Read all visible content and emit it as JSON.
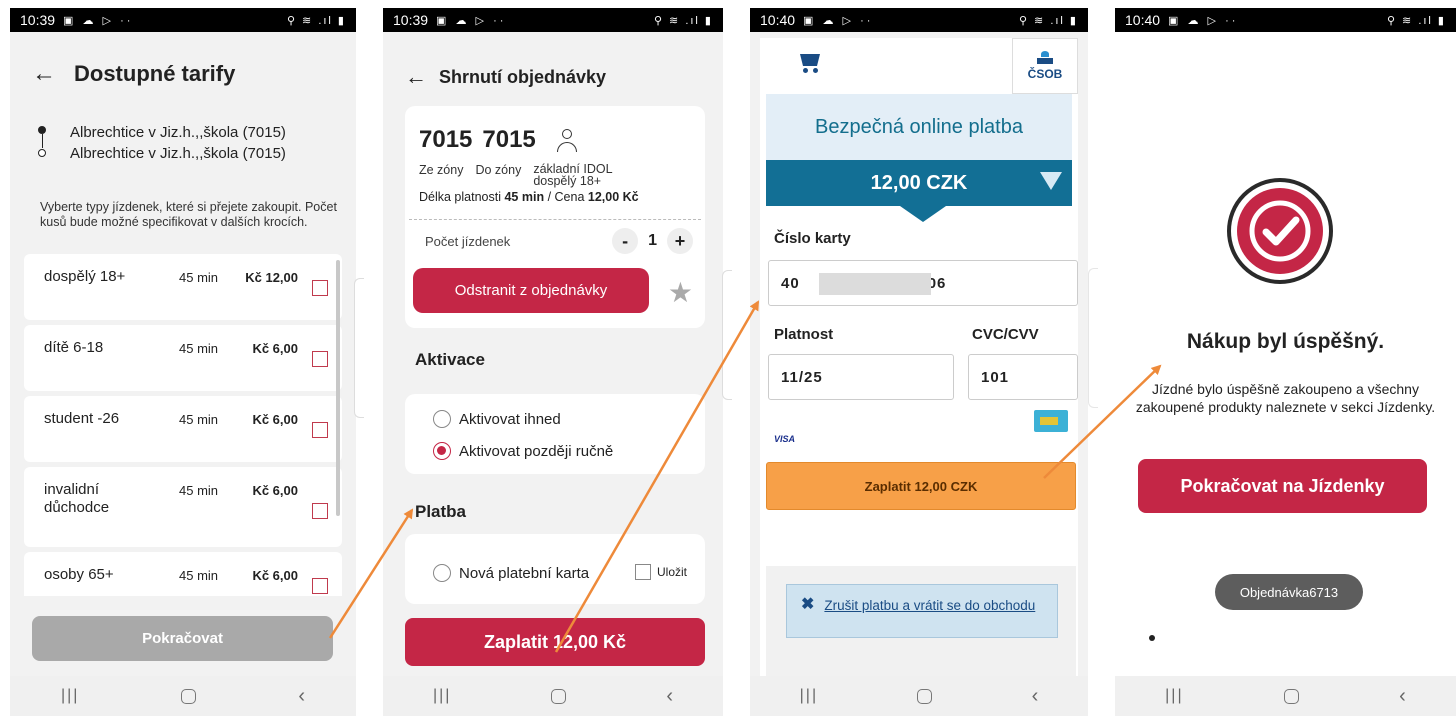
{
  "phone1": {
    "status": {
      "time": "10:39"
    },
    "title": "Dostupné tarify",
    "route": {
      "from": "Albrechtice v Jiz.h.,,škola (7015)",
      "to": "Albrechtice v Jiz.h.,,škola (7015)"
    },
    "hint": "Vyberte typy jízdenek, které si přejete zakoupit. Počet kusů bude možné specifikovat v dalších krocích.",
    "tariffs": [
      {
        "name": "dospělý 18+",
        "duration": "45 min",
        "price": "Kč 12,00"
      },
      {
        "name": "dítě 6-18",
        "duration": "45 min",
        "price": "Kč 6,00"
      },
      {
        "name": "student -26",
        "duration": "45 min",
        "price": "Kč 6,00"
      },
      {
        "name": "invalidní důchodce",
        "duration": "45 min",
        "price": "Kč 6,00"
      },
      {
        "name": "osoby 65+",
        "duration": "45 min",
        "price": "Kč 6,00"
      }
    ],
    "continue_label": "Pokračovat"
  },
  "phone2": {
    "status": {
      "time": "10:39"
    },
    "title": "Shrnutí objednávky",
    "ticket": {
      "zone_from": "7015",
      "zone_to": "7015",
      "from_label": "Ze zóny",
      "to_label": "Do zóny",
      "tariff": "základní IDOL dospělý 18+",
      "validity_label": "Délka platnosti",
      "validity": "45 min",
      "price_label": "/ Cena",
      "price": "12,00 Kč",
      "count_label": "Počet jízdenek",
      "count": "1",
      "remove_label": "Odstranit z objednávky"
    },
    "activation": {
      "title": "Aktivace",
      "options": [
        {
          "label": "Aktivovat ihned",
          "selected": false
        },
        {
          "label": "Aktivovat později ručně",
          "selected": true
        }
      ]
    },
    "payment": {
      "title": "Platba",
      "new_card": "Nová platební karta",
      "save_label": "Uložit"
    },
    "pay_label": "Zaplatit 12,00 Kč"
  },
  "phone3": {
    "status": {
      "time": "10:40"
    },
    "bank": "ČSOB",
    "banner": "Bezpečná online platba",
    "amount": "12,00 CZK",
    "card_number_label": "Číslo karty",
    "card_number_start": "40",
    "card_number_end": "06",
    "expiry_label": "Platnost",
    "expiry": "11/25",
    "cvc_label": "CVC/CVV",
    "cvc": "101",
    "visa": "VISA",
    "pay_label": "Zaplatit 12,00 CZK",
    "cancel_label": "Zrušit platbu a vrátit se do obchodu"
  },
  "phone4": {
    "status": {
      "time": "10:40"
    },
    "title": "Nákup byl úspěšný.",
    "body": "Jízdné bylo úspěšně zakoupeno a všechny zakoupené produkty naleznete v sekci Jízdenky.",
    "continue_label": "Pokračovat na Jízdenky",
    "toast": "Objednávka6713"
  },
  "colors": {
    "brand_red": "#c42646",
    "csob_blue": "#126f95",
    "pay_orange": "#f7a048",
    "arrow": "#ee8a3a"
  },
  "icons": [
    "back-arrow-icon",
    "person-icon",
    "star-icon",
    "cart-icon",
    "csob-logo",
    "visa-logo",
    "card-icon",
    "success-check-icon",
    "close-icon"
  ]
}
